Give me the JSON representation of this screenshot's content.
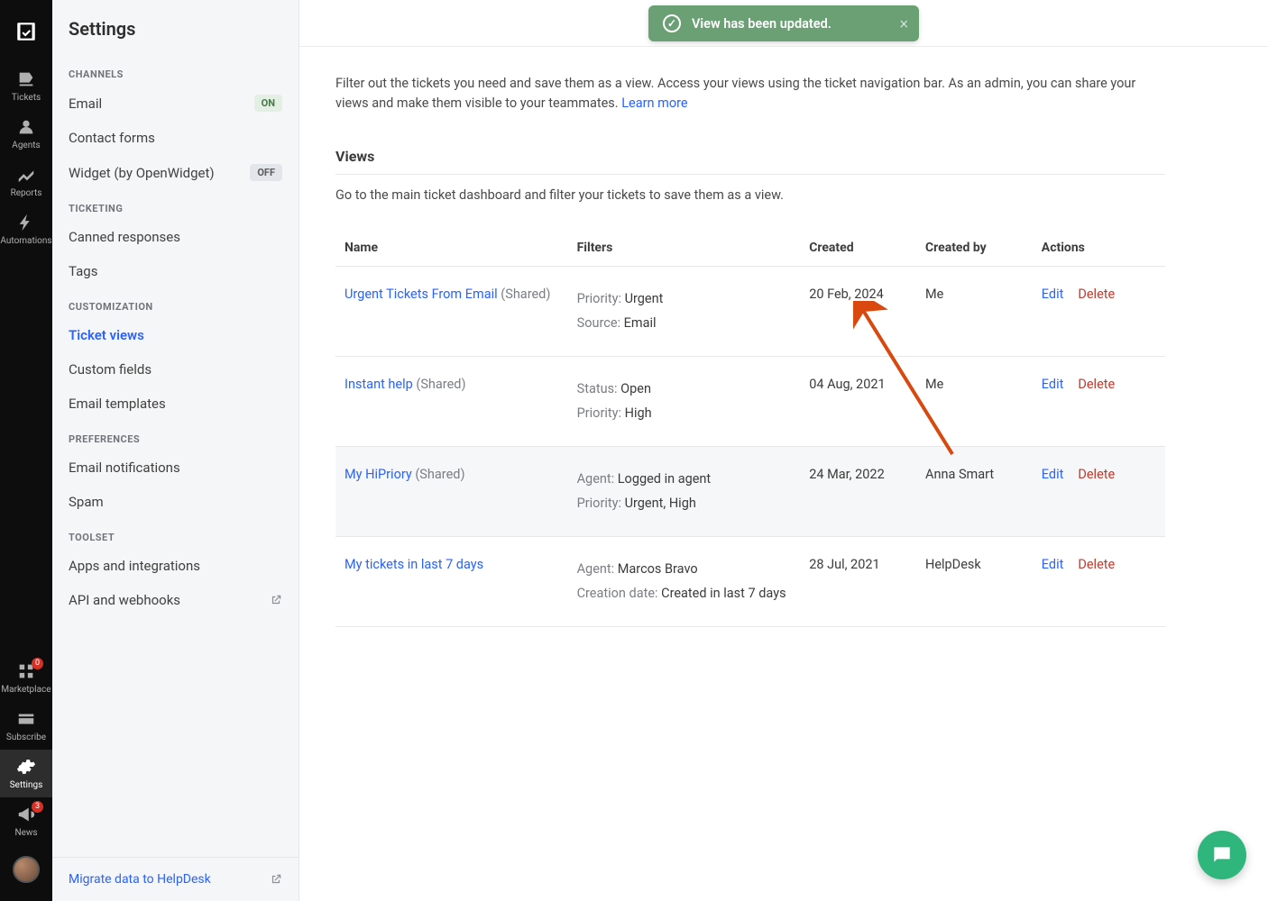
{
  "rail": {
    "items": [
      {
        "label": "Tickets"
      },
      {
        "label": "Agents"
      },
      {
        "label": "Reports"
      },
      {
        "label": "Automations"
      }
    ],
    "bottom": [
      {
        "label": "Marketplace",
        "badge": "0"
      },
      {
        "label": "Subscribe"
      },
      {
        "label": "Settings"
      },
      {
        "label": "News",
        "badge": "3"
      }
    ]
  },
  "settings": {
    "title": "Settings",
    "sections": {
      "channels": {
        "label": "CHANNELS",
        "items": [
          {
            "label": "Email",
            "status": "ON"
          },
          {
            "label": "Contact forms"
          },
          {
            "label": "Widget (by OpenWidget)",
            "status": "OFF"
          }
        ]
      },
      "ticketing": {
        "label": "TICKETING",
        "items": [
          {
            "label": "Canned responses"
          },
          {
            "label": "Tags"
          }
        ]
      },
      "customization": {
        "label": "CUSTOMIZATION",
        "items": [
          {
            "label": "Ticket views"
          },
          {
            "label": "Custom fields"
          },
          {
            "label": "Email templates"
          }
        ]
      },
      "preferences": {
        "label": "PREFERENCES",
        "items": [
          {
            "label": "Email notifications"
          },
          {
            "label": "Spam"
          }
        ]
      },
      "toolset": {
        "label": "TOOLSET",
        "items": [
          {
            "label": "Apps and integrations"
          },
          {
            "label": "API and webhooks"
          }
        ]
      }
    },
    "migrate": "Migrate data to HelpDesk"
  },
  "toast": {
    "text": "View has been updated."
  },
  "page": {
    "title": "Ticket views",
    "desc_pre": "Filter out the tickets you need and save them as a view. Access your views using the ticket navigation bar. As an admin, you can share your views and make them visible to your teammates. ",
    "learn_more": "Learn more",
    "views_heading": "Views",
    "subdesc": "Go to the main ticket dashboard and filter your tickets to save them as a view.",
    "columns": {
      "name": "Name",
      "filters": "Filters",
      "created": "Created",
      "created_by": "Created by",
      "actions": "Actions"
    },
    "edit_label": "Edit",
    "delete_label": "Delete",
    "rows": [
      {
        "name": "Urgent Tickets From Email",
        "shared": "(Shared)",
        "filters": [
          {
            "k": "Priority: ",
            "v": "Urgent"
          },
          {
            "k": "Source: ",
            "v": "Email"
          }
        ],
        "created": "20 Feb, 2024",
        "created_by": "Me"
      },
      {
        "name": "Instant help",
        "shared": "(Shared)",
        "filters": [
          {
            "k": "Status: ",
            "v": "Open"
          },
          {
            "k": "Priority: ",
            "v": "High"
          }
        ],
        "created": "04 Aug, 2021",
        "created_by": "Me"
      },
      {
        "name": "My HiPriory",
        "shared": "(Shared)",
        "filters": [
          {
            "k": "Agent: ",
            "v": "Logged in agent"
          },
          {
            "k": "Priority: ",
            "v": "Urgent, High"
          }
        ],
        "created": "24 Mar, 2022",
        "created_by": "Anna Smart"
      },
      {
        "name": "My tickets in last 7 days",
        "shared": "",
        "filters": [
          {
            "k": "Agent: ",
            "v": "Marcos Bravo"
          },
          {
            "k": "Creation date: ",
            "v": "Created in last 7 days"
          }
        ],
        "created": "28 Jul, 2021",
        "created_by": "HelpDesk"
      }
    ]
  }
}
